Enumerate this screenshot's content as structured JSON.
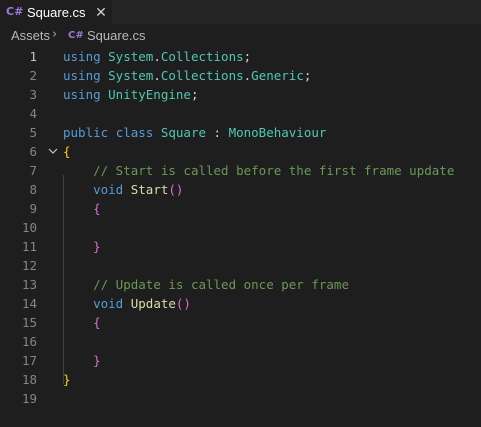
{
  "tab": {
    "title": "Square.cs",
    "icon": "csharp-file-icon",
    "close_glyph": "✕"
  },
  "breadcrumbs": {
    "folder": "Assets",
    "separator": "›",
    "file": "Square.cs",
    "file_icon": "csharp-file-icon"
  },
  "icon_text": "C#",
  "colors": {
    "background": "#1e1e1e",
    "keyword": "#569cd6",
    "type": "#4ec9b0",
    "comment": "#6a9955",
    "function": "#dcdcaa",
    "bracket_level1": "#ffd700",
    "bracket_level2": "#da70d6",
    "line_number": "#858585",
    "active_line_number": "#c6c6c6"
  },
  "editor": {
    "active_line": 1,
    "lines": [
      {
        "num": "1",
        "t": [
          {
            "c": "kw",
            "v": "using "
          },
          {
            "c": "ns",
            "v": "System"
          },
          {
            "c": "plain",
            "v": "."
          },
          {
            "c": "ns",
            "v": "Collections"
          },
          {
            "c": "plain",
            "v": ";"
          }
        ]
      },
      {
        "num": "2",
        "t": [
          {
            "c": "kw",
            "v": "using "
          },
          {
            "c": "ns",
            "v": "System"
          },
          {
            "c": "plain",
            "v": "."
          },
          {
            "c": "ns",
            "v": "Collections"
          },
          {
            "c": "plain",
            "v": "."
          },
          {
            "c": "ns",
            "v": "Generic"
          },
          {
            "c": "plain",
            "v": ";"
          }
        ]
      },
      {
        "num": "3",
        "t": [
          {
            "c": "kw",
            "v": "using "
          },
          {
            "c": "ns",
            "v": "UnityEngine"
          },
          {
            "c": "plain",
            "v": ";"
          }
        ]
      },
      {
        "num": "4",
        "t": []
      },
      {
        "num": "5",
        "t": [
          {
            "c": "kw",
            "v": "public "
          },
          {
            "c": "kw",
            "v": "class "
          },
          {
            "c": "ty",
            "v": "Square"
          },
          {
            "c": "plain",
            "v": " : "
          },
          {
            "c": "ty",
            "v": "MonoBehaviour"
          }
        ]
      },
      {
        "num": "6",
        "fold": true,
        "t": [
          {
            "c": "br1",
            "v": "{"
          }
        ]
      },
      {
        "num": "7",
        "t": [
          {
            "c": "plain",
            "v": "    "
          },
          {
            "c": "cm",
            "v": "// Start is called before the first frame update"
          }
        ]
      },
      {
        "num": "8",
        "t": [
          {
            "c": "plain",
            "v": "    "
          },
          {
            "c": "kw",
            "v": "void "
          },
          {
            "c": "fn",
            "v": "Start"
          },
          {
            "c": "br2",
            "v": "()"
          }
        ]
      },
      {
        "num": "9",
        "t": [
          {
            "c": "plain",
            "v": "    "
          },
          {
            "c": "br2",
            "v": "{"
          }
        ]
      },
      {
        "num": "10",
        "t": []
      },
      {
        "num": "11",
        "t": [
          {
            "c": "plain",
            "v": "    "
          },
          {
            "c": "br2",
            "v": "}"
          }
        ]
      },
      {
        "num": "12",
        "t": []
      },
      {
        "num": "13",
        "t": [
          {
            "c": "plain",
            "v": "    "
          },
          {
            "c": "cm",
            "v": "// Update is called once per frame"
          }
        ]
      },
      {
        "num": "14",
        "t": [
          {
            "c": "plain",
            "v": "    "
          },
          {
            "c": "kw",
            "v": "void "
          },
          {
            "c": "fn",
            "v": "Update"
          },
          {
            "c": "br2",
            "v": "()"
          }
        ]
      },
      {
        "num": "15",
        "t": [
          {
            "c": "plain",
            "v": "    "
          },
          {
            "c": "br2",
            "v": "{"
          }
        ]
      },
      {
        "num": "16",
        "t": []
      },
      {
        "num": "17",
        "t": [
          {
            "c": "plain",
            "v": "    "
          },
          {
            "c": "br2",
            "v": "}"
          }
        ]
      },
      {
        "num": "18",
        "t": [
          {
            "c": "br1",
            "v": "}"
          }
        ]
      },
      {
        "num": "19",
        "t": []
      }
    ]
  }
}
